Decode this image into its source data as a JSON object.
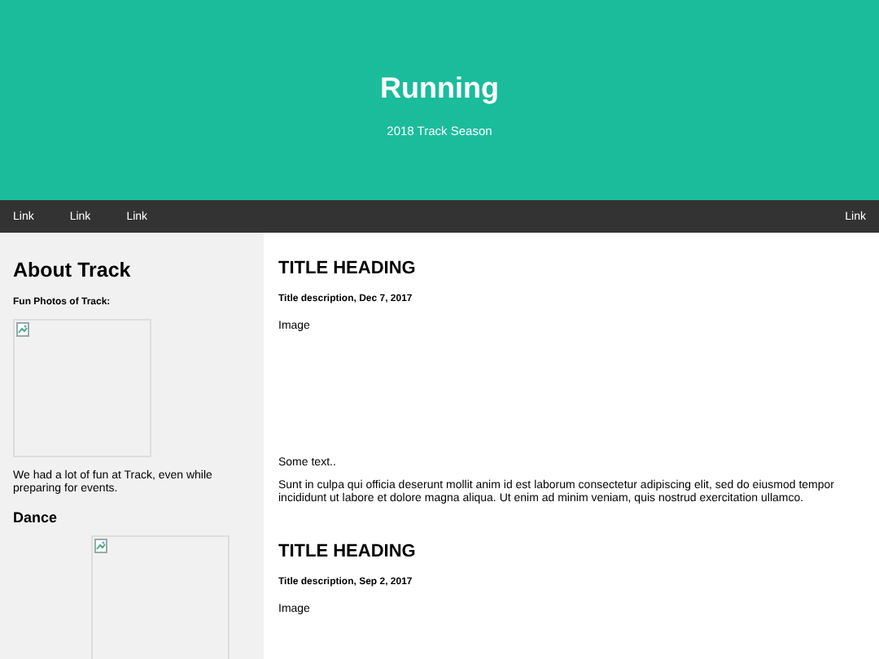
{
  "header": {
    "title": "Running",
    "subtitle": "2018 Track Season"
  },
  "nav": {
    "links": [
      "Link",
      "Link",
      "Link"
    ],
    "right_link": "Link"
  },
  "sidebar": {
    "title": "About Track",
    "subtitle": "Fun Photos of Track:",
    "caption": "We had a lot of fun at Track, even while preparing for events.",
    "section": "Dance"
  },
  "posts": [
    {
      "title": "TITLE HEADING",
      "description": "Title description, Dec 7, 2017",
      "image_label": "Image",
      "texts": [
        "Some text..",
        "Sunt in culpa qui officia deserunt mollit anim id est laborum consectetur adipiscing elit, sed do eiusmod tempor incididunt ut labore et dolore magna aliqua. Ut enim ad minim veniam, quis nostrud exercitation ullamco."
      ]
    },
    {
      "title": "TITLE HEADING",
      "description": "Title description, Sep 2, 2017",
      "image_label": "Image"
    }
  ]
}
